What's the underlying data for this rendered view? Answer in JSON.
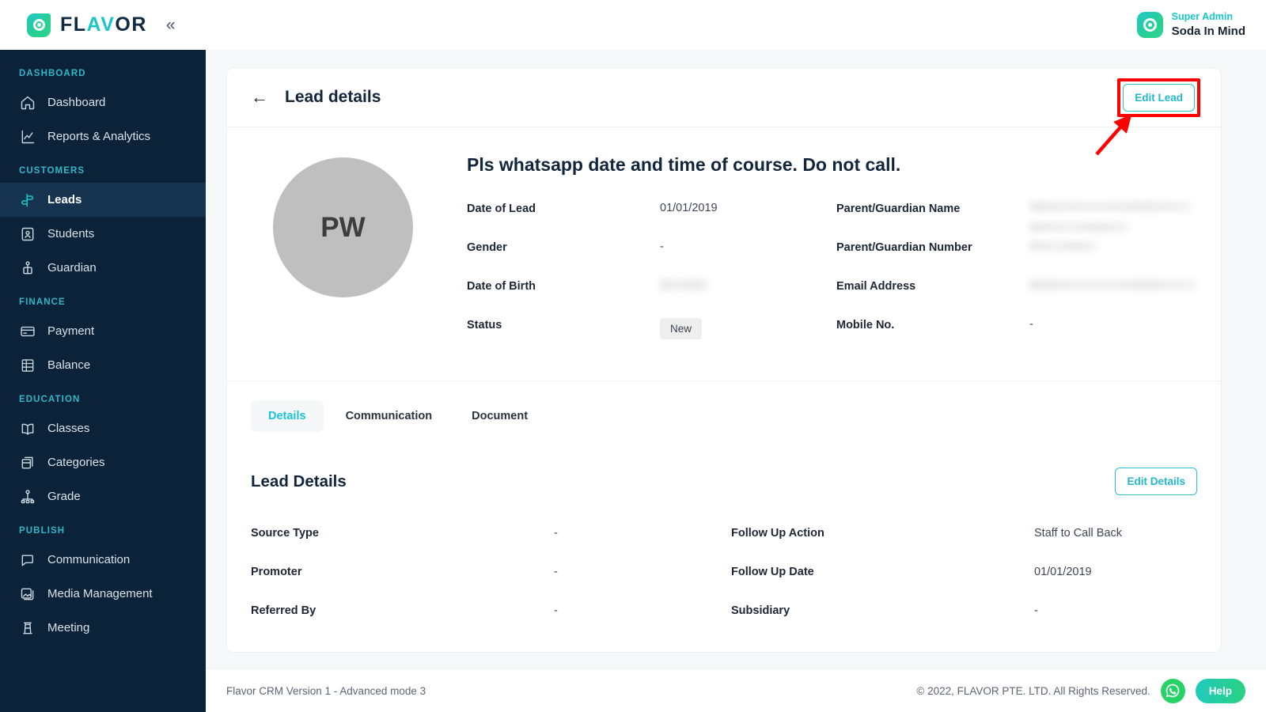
{
  "brand": {
    "logo_text_1": "FL",
    "logo_text_2": "AV",
    "logo_text_3": "OR",
    "collapse_glyph": "«",
    "accent": "#19c6c6",
    "sidebar_bg": "#0b2239",
    "highlight_color": "#ff0000"
  },
  "topbar": {
    "user_role": "Super Admin",
    "user_name": "Soda In Mind"
  },
  "sidebar": {
    "sections": [
      {
        "label": "DASHBOARD",
        "items": [
          {
            "label": "Dashboard",
            "icon": "home-icon",
            "active": false
          },
          {
            "label": "Reports & Analytics",
            "icon": "chart-line-icon",
            "active": false
          }
        ]
      },
      {
        "label": "CUSTOMERS",
        "items": [
          {
            "label": "Leads",
            "icon": "signpost-icon",
            "active": true
          },
          {
            "label": "Students",
            "icon": "id-card-icon",
            "active": false
          },
          {
            "label": "Guardian",
            "icon": "guardian-icon",
            "active": false
          }
        ]
      },
      {
        "label": "FINANCE",
        "items": [
          {
            "label": "Payment",
            "icon": "credit-card-icon",
            "active": false
          },
          {
            "label": "Balance",
            "icon": "ledger-icon",
            "active": false
          }
        ]
      },
      {
        "label": "EDUCATION",
        "items": [
          {
            "label": "Classes",
            "icon": "book-icon",
            "active": false
          },
          {
            "label": "Categories",
            "icon": "boxes-icon",
            "active": false
          },
          {
            "label": "Grade",
            "icon": "hierarchy-icon",
            "active": false
          }
        ]
      },
      {
        "label": "PUBLISH",
        "items": [
          {
            "label": "Communication",
            "icon": "chat-bubble-icon",
            "active": false
          },
          {
            "label": "Media Management",
            "icon": "image-stack-icon",
            "active": false
          },
          {
            "label": "Meeting",
            "icon": "podium-icon",
            "active": false
          }
        ]
      }
    ]
  },
  "page": {
    "back_glyph": "←",
    "title": "Lead details",
    "edit_lead_label": "Edit Lead"
  },
  "profile": {
    "avatar_initials": "PW",
    "lead_name": "Pls whatsapp date and time of course. Do not call.",
    "left_fields": [
      {
        "label": "Date of Lead",
        "value": "01/01/2019",
        "type": "text"
      },
      {
        "label": "Gender",
        "value": "-",
        "type": "text"
      },
      {
        "label": "Date of Birth",
        "value": "",
        "type": "redacted"
      },
      {
        "label": "Status",
        "value": "New",
        "type": "badge"
      }
    ],
    "right_fields": [
      {
        "label": "Parent/Guardian Name",
        "value": "",
        "type": "redacted"
      },
      {
        "label": "Parent/Guardian Number",
        "value": "",
        "type": "redacted"
      },
      {
        "label": "Email Address",
        "value": "",
        "type": "redacted"
      },
      {
        "label": "Mobile No.",
        "value": "-",
        "type": "text"
      }
    ]
  },
  "tabs": [
    {
      "label": "Details",
      "active": true
    },
    {
      "label": "Communication",
      "active": false
    },
    {
      "label": "Document",
      "active": false
    }
  ],
  "lead_details": {
    "title": "Lead Details",
    "edit_details_label": "Edit Details",
    "left_rows": [
      {
        "label": "Source Type",
        "value": "-"
      },
      {
        "label": "Promoter",
        "value": "-"
      },
      {
        "label": "Referred By",
        "value": "-"
      }
    ],
    "right_rows": [
      {
        "label": "Follow Up Action",
        "value": "Staff to Call Back"
      },
      {
        "label": "Follow Up Date",
        "value": "01/01/2019"
      },
      {
        "label": "Subsidiary",
        "value": "-"
      }
    ]
  },
  "footer": {
    "version": "Flavor CRM Version 1 - Advanced mode 3",
    "copyright": "© 2022, FLAVOR PTE. LTD. All Rights Reserved.",
    "help_label": "Help"
  }
}
